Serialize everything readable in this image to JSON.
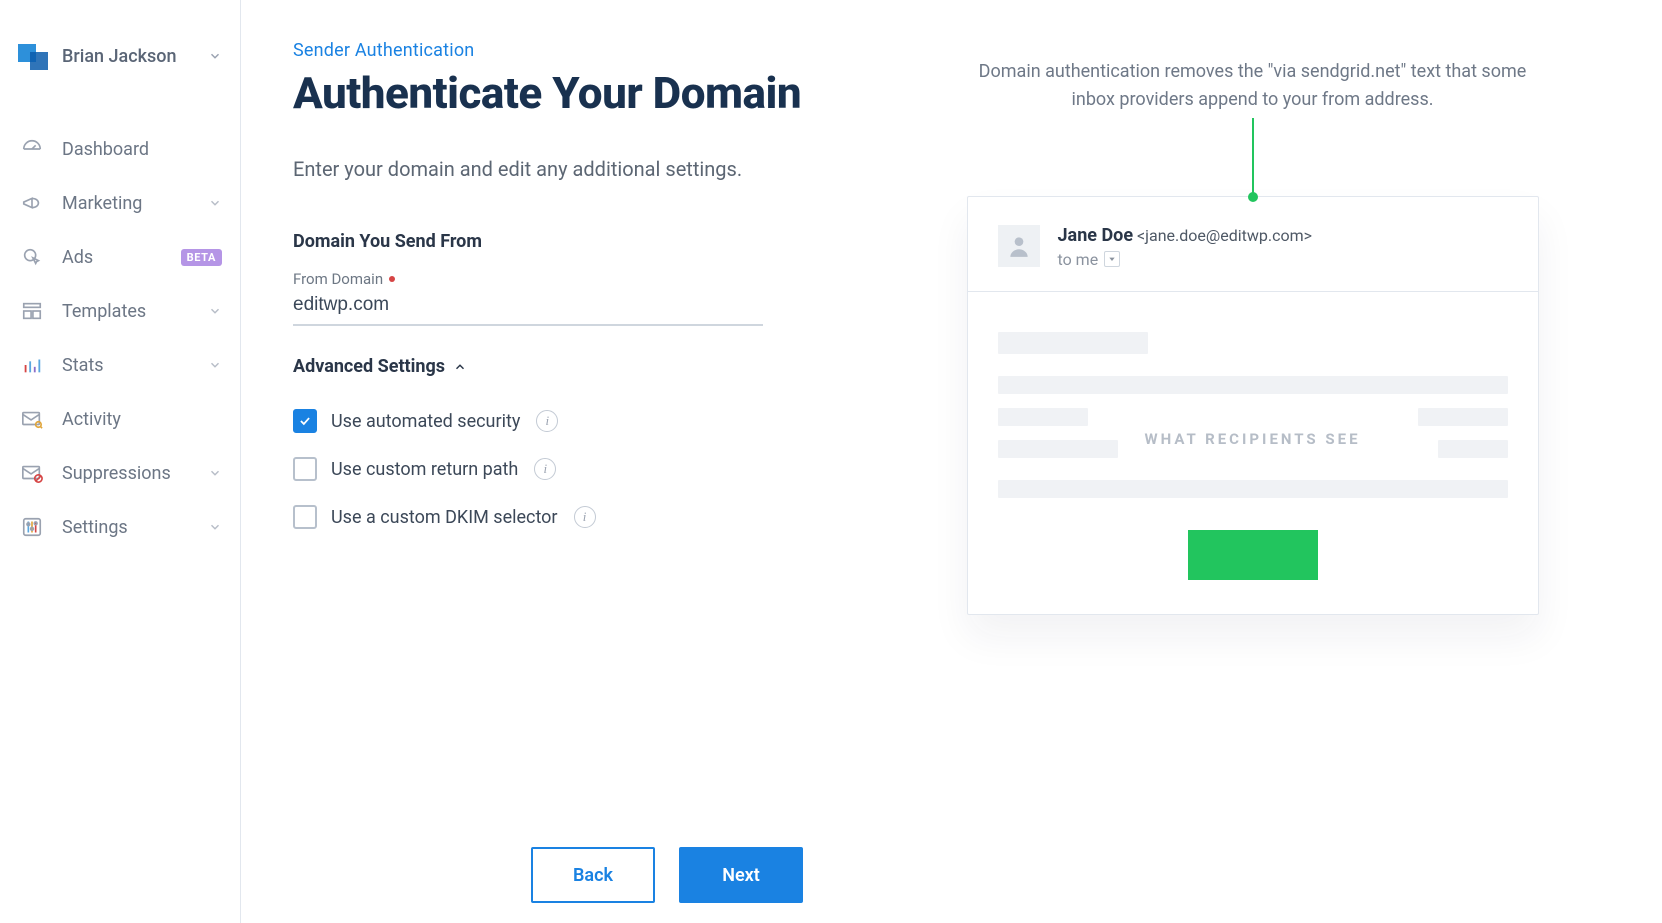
{
  "user": {
    "name": "Brian Jackson"
  },
  "sidebar": {
    "items": [
      {
        "label": "Dashboard",
        "expandable": false
      },
      {
        "label": "Marketing",
        "expandable": true
      },
      {
        "label": "Ads",
        "expandable": false,
        "badge": "BETA"
      },
      {
        "label": "Templates",
        "expandable": true
      },
      {
        "label": "Stats",
        "expandable": true
      },
      {
        "label": "Activity",
        "expandable": false
      },
      {
        "label": "Suppressions",
        "expandable": true
      },
      {
        "label": "Settings",
        "expandable": true
      }
    ]
  },
  "breadcrumb": "Sender Authentication",
  "title": "Authenticate Your Domain",
  "intro": "Enter your domain and edit any additional settings.",
  "form": {
    "section_label": "Domain You Send From",
    "from_domain_label": "From Domain",
    "from_domain_value": "editwp.com",
    "advanced_label": "Advanced Settings",
    "options": {
      "automated_security": {
        "label": "Use automated security",
        "checked": true
      },
      "custom_return_path": {
        "label": "Use custom return path",
        "checked": false
      },
      "custom_dkim": {
        "label": "Use a custom DKIM selector",
        "checked": false
      }
    }
  },
  "actions": {
    "back": "Back",
    "next": "Next"
  },
  "preview": {
    "explain": "Domain authentication removes the \"via sendgrid.net\" text that some inbox providers append to your from address.",
    "from_name": "Jane Doe",
    "from_email": "<jane.doe@editwp.com>",
    "to_line": "to me",
    "recipients_label": "WHAT RECIPIENTS SEE"
  }
}
